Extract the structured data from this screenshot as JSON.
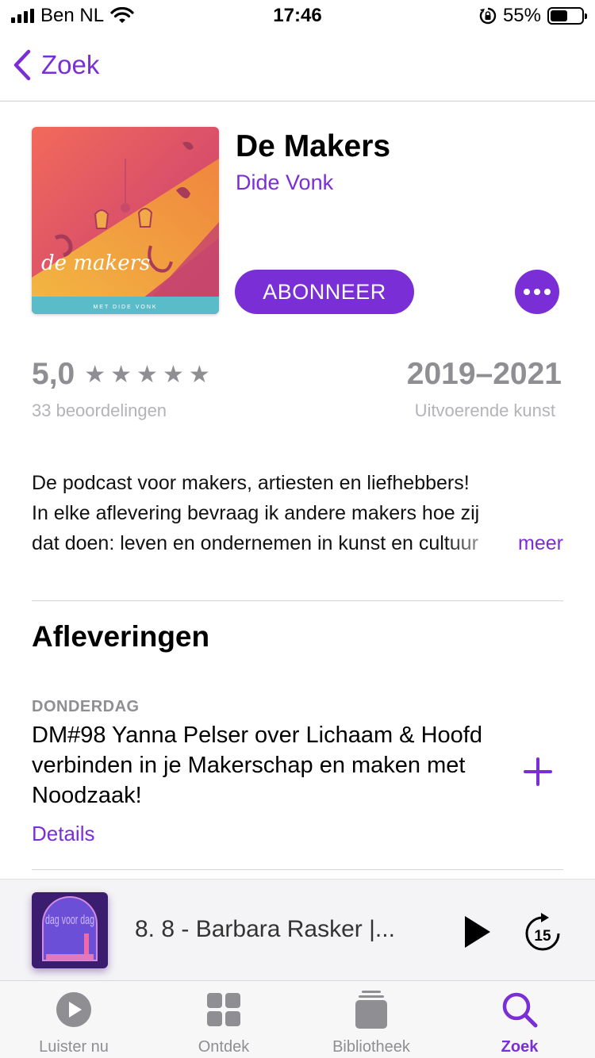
{
  "status": {
    "carrier": "Ben NL",
    "time": "17:46",
    "battery": "55%",
    "battery_level": 0.55
  },
  "nav": {
    "back_label": "Zoek"
  },
  "podcast": {
    "title": "De Makers",
    "author": "Dide Vonk",
    "subscribe_label": "ABONNEER",
    "artwork_title": "de makers",
    "artwork_subtitle": "MET DIDE VONK"
  },
  "rating": {
    "score": "5,0",
    "stars": 5,
    "count_label": "33 beoordelingen"
  },
  "meta": {
    "years": "2019–2021",
    "genre": "Uitvoerende kunst"
  },
  "description": {
    "line1": "De podcast voor makers, artiesten en liefhebbers!",
    "line2": "In elke aflevering bevraag ik andere makers hoe zij",
    "line3": "dat doen: leven en ondernemen in kunst en cultuur",
    "more_label": "meer"
  },
  "episodes": {
    "section_title": "Afleveringen",
    "items": [
      {
        "date": "DONDERDAG",
        "title": "DM#98 Yanna Pelser over Lichaam & Hoofd verbinden in je Makerschap en maken met Noodzaak!",
        "details_label": "Details"
      }
    ]
  },
  "now_playing": {
    "title": "8. 8 - Barbara Rasker |...",
    "art_text": "dag voor dag",
    "skip_seconds": "15"
  },
  "tabs": [
    {
      "label": "Luister nu",
      "icon": "play-circle-icon"
    },
    {
      "label": "Ontdek",
      "icon": "grid-icon"
    },
    {
      "label": "Bibliotheek",
      "icon": "stack-icon"
    },
    {
      "label": "Zoek",
      "icon": "search-icon",
      "active": true
    }
  ],
  "colors": {
    "accent": "#7a2fd6",
    "secondary_text": "#8e8e93",
    "tertiary_text": "#b3b3b8"
  }
}
